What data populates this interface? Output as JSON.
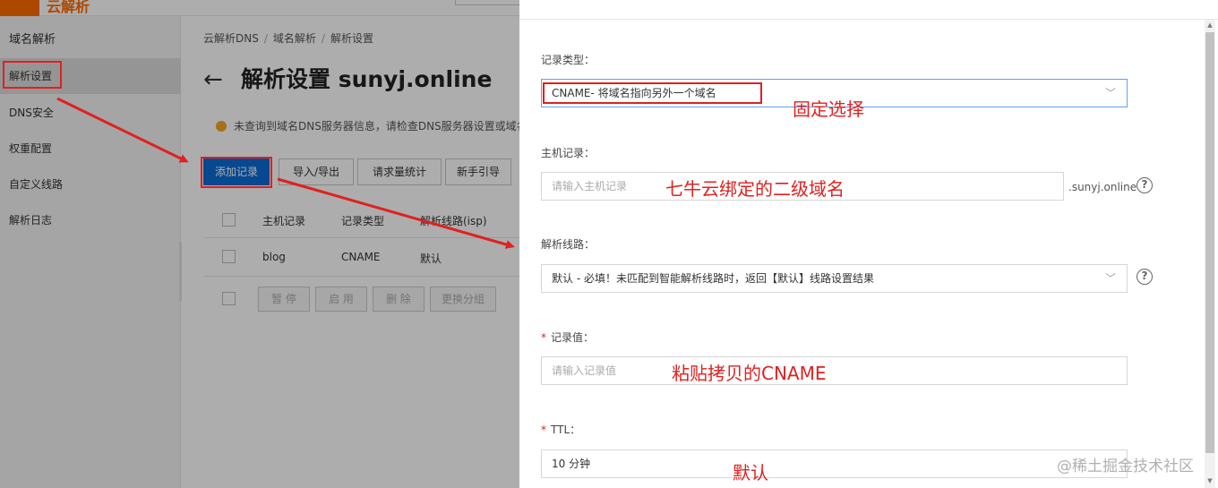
{
  "header": {
    "logo_text": "云解析"
  },
  "sidebar": {
    "title": "域名解析",
    "items": [
      {
        "label": "解析设置",
        "active": true
      },
      {
        "label": "DNS安全"
      },
      {
        "label": "权重配置"
      },
      {
        "label": "自定义线路"
      },
      {
        "label": "解析日志"
      }
    ]
  },
  "breadcrumb": [
    "云解析DNS",
    "域名解析",
    "解析设置"
  ],
  "page": {
    "title": "解析设置 sunyj.online",
    "notice": "未查询到域名DNS服务器信息，请检查DNS服务器设置或域名"
  },
  "toolbar": {
    "add_record": "添加记录",
    "import_export": "导入/导出",
    "request_stats": "请求量统计",
    "beginner_guide": "新手引导"
  },
  "table": {
    "columns": [
      "主机记录",
      "记录类型",
      "解析线路(isp)"
    ],
    "rows": [
      {
        "host": "blog",
        "type": "CNAME",
        "line": "默认"
      }
    ],
    "actions": [
      "暂 停",
      "启 用",
      "删 除",
      "更换分组"
    ]
  },
  "form": {
    "record_type": {
      "label": "记录类型：",
      "value": "CNAME- 将域名指向另外一个域名"
    },
    "host_record": {
      "label": "主机记录：",
      "placeholder": "请输入主机记录",
      "suffix": ".sunyj.online"
    },
    "resolve_line": {
      "label": "解析线路：",
      "value": "默认 - 必填！未匹配到智能解析线路时，返回【默认】线路设置结果"
    },
    "record_value": {
      "label": "记录值：",
      "placeholder": "请输入记录值"
    },
    "ttl": {
      "label": "TTL：",
      "value": "10 分钟"
    }
  },
  "annotations": {
    "fixed_choice": "固定选择",
    "qiniu_subdomain": "七牛云绑定的二级域名",
    "paste_cname": "粘贴拷贝的CNAME",
    "default": "默认"
  },
  "watermark": "@稀土掘金技术社区",
  "colors": {
    "primary": "#0a6cd6",
    "annotation": "#e02020",
    "brand": "#ff6a00"
  }
}
